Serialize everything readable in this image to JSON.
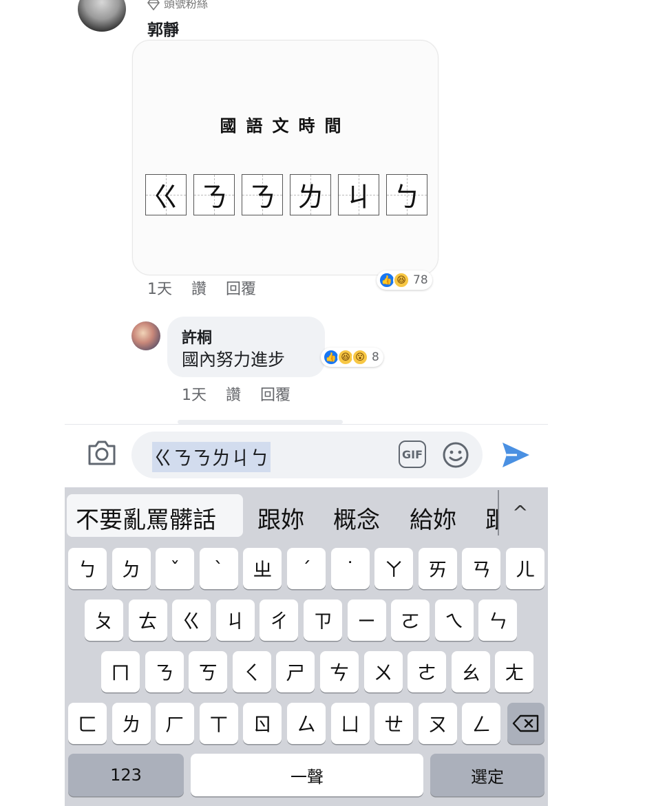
{
  "comment_top": {
    "badge_label": "頭號粉絲",
    "author": "郭靜",
    "image": {
      "title": "國語文時間",
      "boxes": [
        "ㄍ",
        "ㄋ",
        "ㄋ",
        "ㄌ",
        "ㄐ",
        "ㄅ"
      ]
    },
    "time": "1天",
    "like_label": "讚",
    "reply_label": "回覆",
    "reaction_count": "78"
  },
  "comment_second": {
    "author": "許桐",
    "text": "國內努力進步",
    "time": "1天",
    "like_label": "讚",
    "reply_label": "回覆",
    "reaction_count": "8"
  },
  "composer": {
    "input_text": "ㄍㄋㄋㄌㄐㄅ",
    "gif_label": "GIF",
    "icons": [
      "camera-icon",
      "gif-icon",
      "emoji-icon",
      "send-icon"
    ],
    "accent_color": "#4a90e2"
  },
  "keyboard": {
    "candidates": [
      "不要亂罵髒話",
      "跟妳",
      "概念",
      "給妳",
      "跟"
    ],
    "expand_glyph": "^",
    "row1": [
      "ㄅ",
      "ㄉ",
      "ˇ",
      "ˋ",
      "ㄓ",
      "ˊ",
      "˙",
      "ㄚ",
      "ㄞ",
      "ㄢ",
      "ㄦ"
    ],
    "row2": [
      "ㄆ",
      "ㄊ",
      "ㄍ",
      "ㄐ",
      "ㄔ",
      "ㄗ",
      "ㄧ",
      "ㄛ",
      "ㄟ",
      "ㄣ"
    ],
    "row3": [
      "ㄇ",
      "ㄋ",
      "ㄎ",
      "ㄑ",
      "ㄕ",
      "ㄘ",
      "ㄨ",
      "ㄜ",
      "ㄠ",
      "ㄤ"
    ],
    "row4": [
      "ㄈ",
      "ㄌ",
      "ㄏ",
      "ㄒ",
      "ㄖ",
      "ㄙ",
      "ㄩ",
      "ㄝ",
      "ㄡ",
      "ㄥ"
    ],
    "numbers_key": "123",
    "tone_key": "一聲",
    "select_key": "選定"
  }
}
